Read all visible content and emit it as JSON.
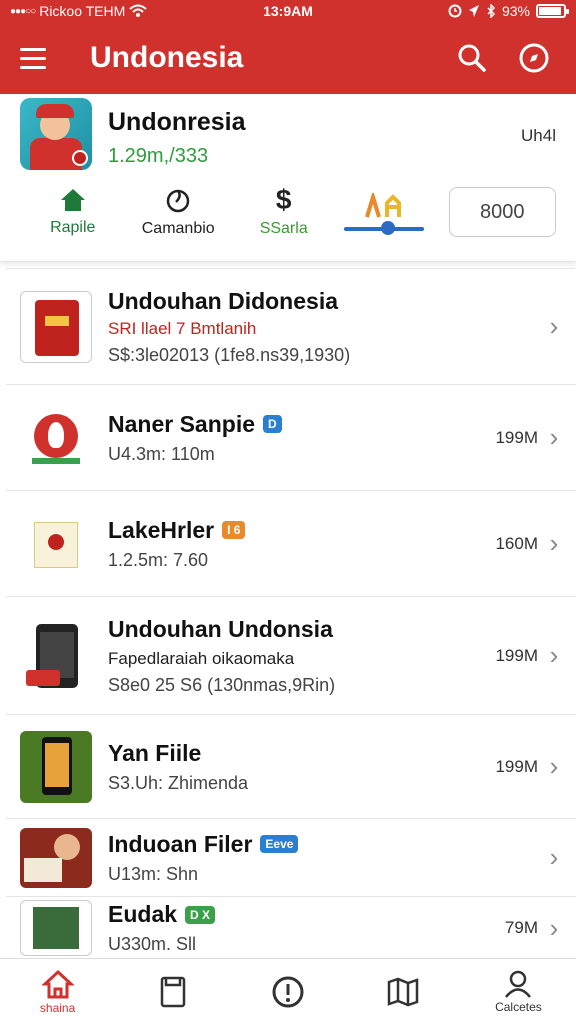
{
  "status": {
    "carrier": "Rickoo TEHM",
    "time": "13:9AM",
    "battery": "93%",
    "battery_level": 0.93
  },
  "app_bar": {
    "title": "Undonesia"
  },
  "header": {
    "name": "Undonresia",
    "subtitle": "1.29m,/333",
    "right": "Uh4l",
    "quick": [
      {
        "label": "Rapile",
        "icon": "home-icon",
        "color": "#1f7a3a"
      },
      {
        "label": "Camanbio",
        "icon": "leaf-icon",
        "color": "#222"
      },
      {
        "label": "SSarla",
        "icon": "dollar-icon",
        "color": "#3a9b2f"
      }
    ],
    "slider_value": 0.55,
    "box_value": "8000"
  },
  "list": [
    {
      "title": "Undouhan Didonesia",
      "tag": "",
      "subtitle1": "SRI llael 7 Bmtlanih",
      "subtitle": "S$:3le02013 (1fe8.ns39,1930)",
      "size": ""
    },
    {
      "title": "Naner Sanpie",
      "tag": "D",
      "tag_color": "#2b7fd1",
      "subtitle1": "",
      "subtitle": "U4.3m: 110m",
      "size": "199M"
    },
    {
      "title": "LakeHrler",
      "tag": "I 6",
      "tag_color": "#e8892a",
      "subtitle1": "",
      "subtitle": "1.2.5m: 7.60",
      "size": "160M"
    },
    {
      "title": "Undouhan Undonsia",
      "tag": "",
      "subtitle1": "Fapedlaraiah oikaomaka",
      "subtitle": "S8e0 25 S6 (130nmas,9Rin)",
      "size": "199M"
    },
    {
      "title": "Yan Fiile",
      "tag": "",
      "subtitle1": "",
      "subtitle": "S3.Uh: Zhimenda",
      "size": "199M"
    },
    {
      "title": "Induoan Filer",
      "tag": "Eeve",
      "tag_color": "#2b7fd1",
      "subtitle1": "",
      "subtitle": "U13m: Shn",
      "size": ""
    },
    {
      "title": "Eudak",
      "tag": "D X",
      "tag_color": "#3aa14a",
      "subtitle1": "",
      "subtitle": "U330m. Sll",
      "size": "79M"
    }
  ],
  "bottom_nav": [
    {
      "label": "shaina",
      "icon": "home-icon",
      "active": true
    },
    {
      "label": "",
      "icon": "document-icon",
      "active": false
    },
    {
      "label": "",
      "icon": "info-icon",
      "active": false
    },
    {
      "label": "",
      "icon": "map-icon",
      "active": false
    },
    {
      "label": "Calcetes",
      "icon": "profile-icon",
      "active": false
    }
  ],
  "colors": {
    "brand": "#d0312d",
    "accent_green": "#2e9d3c",
    "slider_blue": "#2b6bc1"
  }
}
